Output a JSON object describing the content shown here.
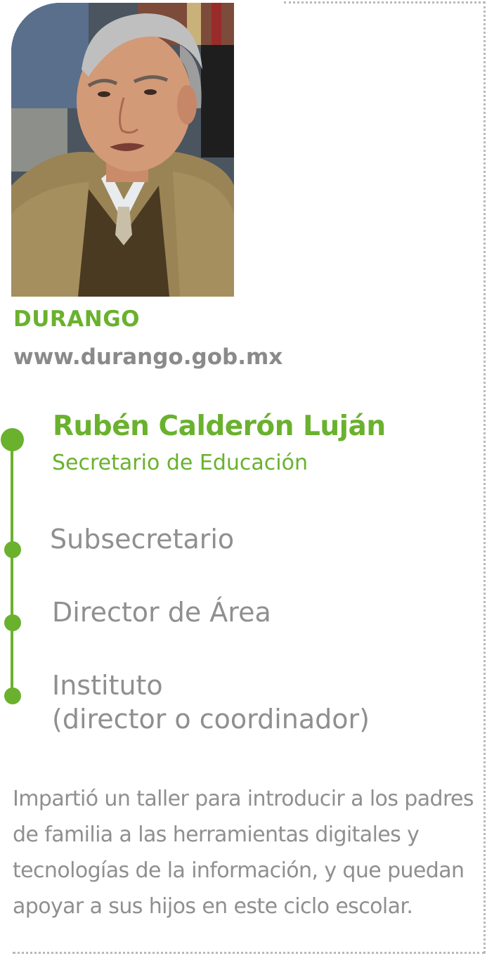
{
  "profile": {
    "photo_alt": "Retrato de Rubén Calderón Luján",
    "state": "DURANGO",
    "website": "www.durango.gob.mx"
  },
  "official": {
    "name": "Rubén Calderón Luján",
    "role": "Secretario de Educación"
  },
  "hierarchy": {
    "levels": [
      {
        "lines": [
          "Subsecretario"
        ]
      },
      {
        "lines": [
          "Director de Área"
        ]
      },
      {
        "lines": [
          "Instituto",
          "(director o coordinador)"
        ]
      }
    ]
  },
  "description": "Impartió un taller para introducir a los padres de familia a las herramientas digitales y tecnologías de la información, y que puedan apoyar a sus hijos en este ciclo escolar.",
  "colors": {
    "accent": "#6ab12e",
    "text_gray": "#8f8f8f",
    "dotted_border": "#b9b9b9"
  }
}
